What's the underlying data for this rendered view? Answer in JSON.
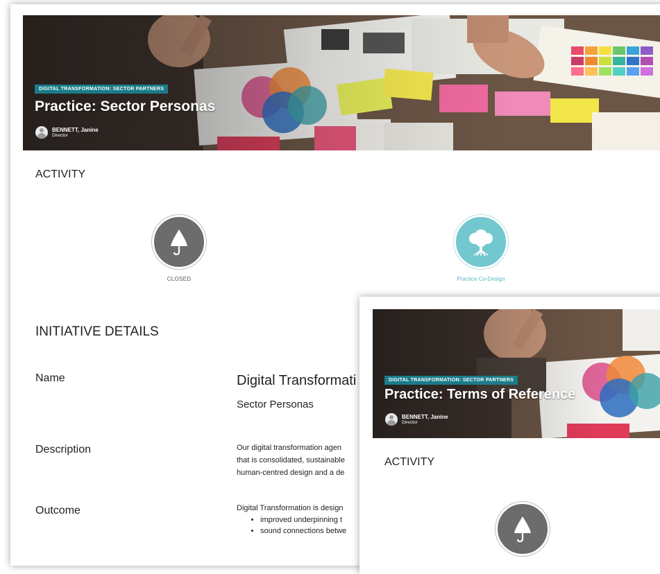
{
  "main_card": {
    "tag": "DIGITAL TRANSFORMATION: SECTOR PARTNERS",
    "title": "Practice: Sector Personas",
    "author_name": "BENNETT, Janine",
    "author_role": "Director",
    "activity_heading": "ACTIVITY",
    "activities": [
      {
        "label": "CLOSED",
        "icon": "umbrella-icon",
        "color": "#6c6c6c"
      },
      {
        "label": "Practice Co-Design",
        "icon": "tree-icon",
        "color": "#73c8cf"
      }
    ],
    "details_heading": "INITIATIVE DETAILS",
    "name_label": "Name",
    "name_value_1": "Digital Transformati",
    "name_value_2": "Sector Personas",
    "description_label": "Description",
    "description_lines": [
      "Our digital transformation agen",
      "that is consolidated, sustainable",
      "human-centred design and a de"
    ],
    "outcome_label": "Outcome",
    "outcome_intro": "Digital Transformation is design",
    "outcome_bullets": [
      "improved underpinning t",
      "sound connections betwe"
    ]
  },
  "overlay_card": {
    "tag": "DIGITAL TRANSFORMATION: SECTOR PARTNERS",
    "title": "Practice: Terms of Reference",
    "author_name": "BENNETT, Janine",
    "author_role": "Director",
    "activity_heading": "ACTIVITY",
    "activity_icon": "umbrella-icon"
  }
}
